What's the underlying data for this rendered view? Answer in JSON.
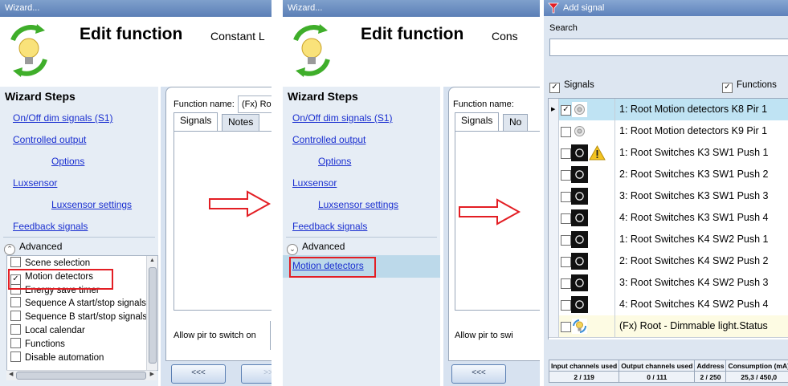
{
  "panel1": {
    "window_title": "Wizard...",
    "title": "Edit function",
    "subtitle": "Constant L",
    "steps_heading": "Wizard Steps",
    "steps": [
      "On/Off dim signals (S1)",
      "Controlled output",
      "Options",
      "Luxsensor",
      "Luxsensor settings",
      "Feedback signals"
    ],
    "advanced_label": "Advanced",
    "advanced_items": [
      {
        "label": "Scene selection",
        "checked": false
      },
      {
        "label": "Motion detectors",
        "checked": true
      },
      {
        "label": "Energy save timer",
        "checked": false
      },
      {
        "label": "Sequence A start/stop signals",
        "checked": false
      },
      {
        "label": "Sequence B start/stop signals",
        "checked": false
      },
      {
        "label": "Local calendar",
        "checked": false
      },
      {
        "label": "Functions",
        "checked": false
      },
      {
        "label": "Disable automation",
        "checked": false
      }
    ],
    "function_name_label": "Function name:",
    "function_name_value": "(Fx) Ro",
    "tabs": [
      "Signals",
      "Notes"
    ],
    "allow_pir_label": "Allow pir to switch on",
    "back_button": "<<<",
    "next_button": ">>"
  },
  "panel2": {
    "window_title": "Wizard...",
    "title": "Edit function",
    "subtitle": "Cons",
    "steps_heading": "Wizard Steps",
    "steps": [
      "On/Off dim signals (S1)",
      "Controlled output",
      "Options",
      "Luxsensor",
      "Luxsensor settings",
      "Feedback signals"
    ],
    "advanced_label": "Advanced",
    "selected_step": "Motion detectors",
    "function_name_label": "Function name:",
    "tabs": [
      "Signals",
      "No"
    ],
    "allow_pir_label": "Allow pir to swi",
    "back_button": "<<<"
  },
  "panel3": {
    "window_title": "Add signal",
    "search_label": "Search",
    "search_value": "",
    "filter_signals": "Signals",
    "filter_functions": "Functions",
    "rows": [
      {
        "label": "1: Root Motion detectors K8 Pir 1",
        "checked": true,
        "icon": "pir-sensor-icon",
        "warning": false,
        "highlight": true
      },
      {
        "label": "1: Root Motion detectors K9 Pir 1",
        "checked": false,
        "icon": "pir-sensor-icon",
        "warning": false,
        "highlight": false
      },
      {
        "label": "1: Root Switches K3 SW1 Push 1",
        "checked": false,
        "icon": "push-button-icon",
        "warning": true,
        "highlight": false
      },
      {
        "label": "2: Root Switches K3 SW1 Push 2",
        "checked": false,
        "icon": "push-button-icon",
        "warning": false,
        "highlight": false
      },
      {
        "label": "3: Root Switches K3 SW1 Push 3",
        "checked": false,
        "icon": "push-button-icon",
        "warning": false,
        "highlight": false
      },
      {
        "label": "4: Root Switches K3 SW1 Push 4",
        "checked": false,
        "icon": "push-button-icon",
        "warning": false,
        "highlight": false
      },
      {
        "label": "1: Root Switches K4 SW2 Push 1",
        "checked": false,
        "icon": "push-button-icon",
        "warning": false,
        "highlight": false
      },
      {
        "label": "2: Root Switches K4 SW2 Push 2",
        "checked": false,
        "icon": "push-button-icon",
        "warning": false,
        "highlight": false
      },
      {
        "label": "3: Root Switches K4 SW2 Push 3",
        "checked": false,
        "icon": "push-button-icon",
        "warning": false,
        "highlight": false
      },
      {
        "label": "4: Root Switches K4 SW2 Push 4",
        "checked": false,
        "icon": "push-button-icon",
        "warning": false,
        "highlight": false
      },
      {
        "label": "(Fx) Root - Dimmable light.Status",
        "checked": false,
        "icon": "light-bulb-icon",
        "warning": false,
        "highlight": false
      }
    ],
    "stats_headers": [
      "Input channels used",
      "Output channels used",
      "Address",
      "Consumption (mA)"
    ],
    "stats_values": [
      "2 / 119",
      "0 / 111",
      "2 / 250",
      "25,3 / 450,0"
    ]
  },
  "colors": {
    "link": "#1a2fd0",
    "highlight_red": "#e31e24",
    "title_bar": "#5b7fb6",
    "selected_row": "#bfe3f3",
    "function_row": "#fdfbe3"
  }
}
